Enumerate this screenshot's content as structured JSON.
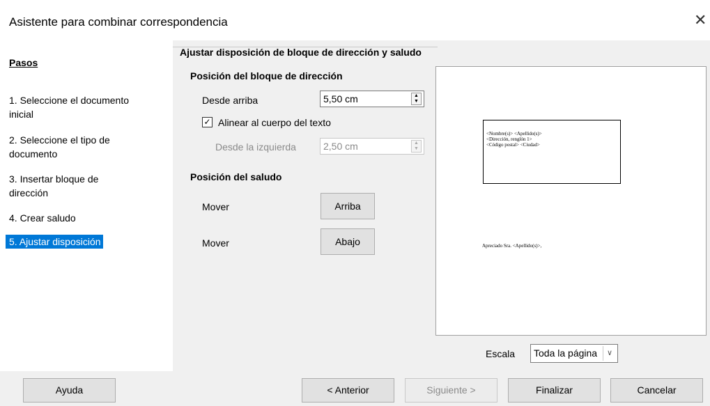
{
  "window": {
    "title": "Asistente para combinar correspondencia",
    "close_glyph": "✕"
  },
  "sidebar": {
    "heading": "Pasos",
    "steps": [
      {
        "label": "1. Seleccione el documento\ninicial"
      },
      {
        "label": "2. Seleccione el tipo de\ndocumento"
      },
      {
        "label": "3. Insertar bloque de\ndirección"
      },
      {
        "label": "4. Crear saludo"
      },
      {
        "label": "5. Ajustar disposición",
        "selected": true
      }
    ]
  },
  "main": {
    "page_title": "Ajustar disposición de bloque de dirección y saludo",
    "address_section": {
      "heading": "Posición del bloque de dirección",
      "from_top_label": "Desde arriba",
      "from_top_value": "5,50 cm",
      "align_checkbox_label": "Alinear al cuerpo del texto",
      "align_checked": true,
      "from_left_label": "Desde la izquierda",
      "from_left_value": "2,50 cm"
    },
    "salutation_section": {
      "heading": "Posición del saludo",
      "move_label_1": "Mover",
      "up_button": "Arriba",
      "move_label_2": "Mover",
      "down_button": "Abajo"
    },
    "preview": {
      "address_lines": [
        "<Nombre(s)> <Apellido(s)>",
        "<Dirección, renglón 1>",
        "<Código postal> <Ciudad>"
      ],
      "salutation": "Apreciado Sra. <Apellido(s)>,"
    },
    "scale": {
      "label": "Escala",
      "value": "Toda la página"
    }
  },
  "footer": {
    "help": "Ayuda",
    "back": "< Anterior",
    "next": "Siguiente >",
    "finish": "Finalizar",
    "cancel": "Cancelar"
  },
  "colors": {
    "selection": "#0078d7",
    "dialog_bg": "#f0f0f0"
  }
}
